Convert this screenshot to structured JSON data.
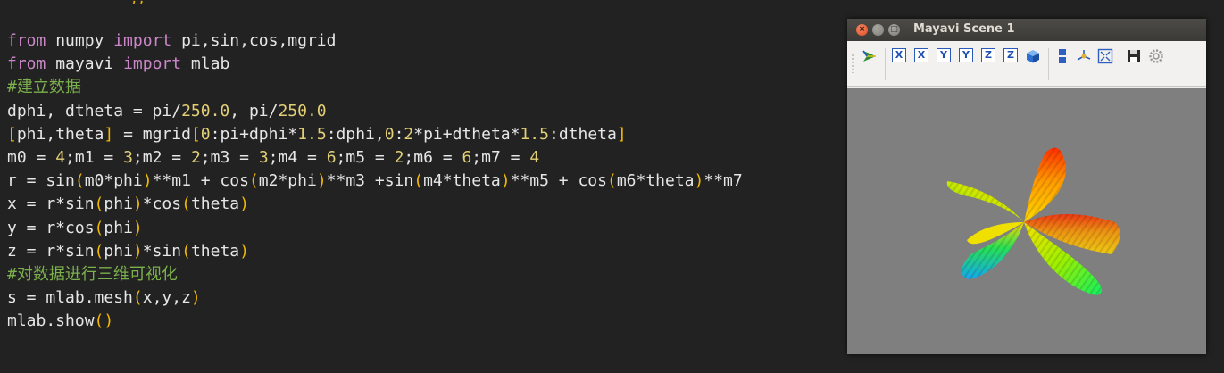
{
  "editor": {
    "lines": [
      {
        "segments": [
          {
            "t": "from",
            "c": "kw"
          },
          {
            "t": " numpy ",
            "c": "tx"
          },
          {
            "t": "import",
            "c": "kw"
          },
          {
            "t": " pi,sin,cos,mgrid",
            "c": "tx"
          }
        ]
      },
      {
        "segments": [
          {
            "t": "from",
            "c": "kw"
          },
          {
            "t": " mayavi ",
            "c": "tx"
          },
          {
            "t": "import",
            "c": "kw"
          },
          {
            "t": " mlab",
            "c": "tx"
          }
        ]
      },
      {
        "segments": [
          {
            "t": "#建立数据",
            "c": "cm"
          }
        ]
      },
      {
        "segments": [
          {
            "t": "dphi, dtheta = pi/",
            "c": "tx"
          },
          {
            "t": "250.0",
            "c": "num"
          },
          {
            "t": ", pi/",
            "c": "tx"
          },
          {
            "t": "250.0",
            "c": "num"
          }
        ]
      },
      {
        "segments": [
          {
            "t": "[",
            "c": "br"
          },
          {
            "t": "phi,theta",
            "c": "tx"
          },
          {
            "t": "]",
            "c": "br"
          },
          {
            "t": " = mgrid",
            "c": "tx"
          },
          {
            "t": "[",
            "c": "br"
          },
          {
            "t": "0",
            "c": "num"
          },
          {
            "t": ":pi+dphi*",
            "c": "tx"
          },
          {
            "t": "1.5",
            "c": "num"
          },
          {
            "t": ":dphi,",
            "c": "tx"
          },
          {
            "t": "0",
            "c": "num"
          },
          {
            "t": ":",
            "c": "tx"
          },
          {
            "t": "2",
            "c": "num"
          },
          {
            "t": "*pi+dtheta*",
            "c": "tx"
          },
          {
            "t": "1.5",
            "c": "num"
          },
          {
            "t": ":dtheta",
            "c": "tx"
          },
          {
            "t": "]",
            "c": "br"
          }
        ]
      },
      {
        "segments": [
          {
            "t": "m0 = ",
            "c": "tx"
          },
          {
            "t": "4",
            "c": "num"
          },
          {
            "t": ";m1 = ",
            "c": "tx"
          },
          {
            "t": "3",
            "c": "num"
          },
          {
            "t": ";m2 = ",
            "c": "tx"
          },
          {
            "t": "2",
            "c": "num"
          },
          {
            "t": ";m3 = ",
            "c": "tx"
          },
          {
            "t": "3",
            "c": "num"
          },
          {
            "t": ";m4 = ",
            "c": "tx"
          },
          {
            "t": "6",
            "c": "num"
          },
          {
            "t": ";m5 = ",
            "c": "tx"
          },
          {
            "t": "2",
            "c": "num"
          },
          {
            "t": ";m6 = ",
            "c": "tx"
          },
          {
            "t": "6",
            "c": "num"
          },
          {
            "t": ";m7 = ",
            "c": "tx"
          },
          {
            "t": "4",
            "c": "num"
          }
        ]
      },
      {
        "segments": [
          {
            "t": "r = sin",
            "c": "tx"
          },
          {
            "t": "(",
            "c": "br"
          },
          {
            "t": "m0*phi",
            "c": "tx"
          },
          {
            "t": ")",
            "c": "br"
          },
          {
            "t": "**m1 + cos",
            "c": "tx"
          },
          {
            "t": "(",
            "c": "br"
          },
          {
            "t": "m2*phi",
            "c": "tx"
          },
          {
            "t": ")",
            "c": "br"
          },
          {
            "t": "**m3 +sin",
            "c": "tx"
          },
          {
            "t": "(",
            "c": "br"
          },
          {
            "t": "m4*theta",
            "c": "tx"
          },
          {
            "t": ")",
            "c": "br"
          },
          {
            "t": "**m5 + cos",
            "c": "tx"
          },
          {
            "t": "(",
            "c": "br"
          },
          {
            "t": "m6*theta",
            "c": "tx"
          },
          {
            "t": ")",
            "c": "br"
          },
          {
            "t": "**m7",
            "c": "tx"
          }
        ]
      },
      {
        "segments": [
          {
            "t": "x = r*sin",
            "c": "tx"
          },
          {
            "t": "(",
            "c": "br"
          },
          {
            "t": "phi",
            "c": "tx"
          },
          {
            "t": ")",
            "c": "br"
          },
          {
            "t": "*cos",
            "c": "tx"
          },
          {
            "t": "(",
            "c": "br"
          },
          {
            "t": "theta",
            "c": "tx"
          },
          {
            "t": ")",
            "c": "br"
          }
        ]
      },
      {
        "segments": [
          {
            "t": "y = r*cos",
            "c": "tx"
          },
          {
            "t": "(",
            "c": "br"
          },
          {
            "t": "phi",
            "c": "tx"
          },
          {
            "t": ")",
            "c": "br"
          }
        ]
      },
      {
        "segments": [
          {
            "t": "z = r*sin",
            "c": "tx"
          },
          {
            "t": "(",
            "c": "br"
          },
          {
            "t": "phi",
            "c": "tx"
          },
          {
            "t": ")",
            "c": "br"
          },
          {
            "t": "*sin",
            "c": "tx"
          },
          {
            "t": "(",
            "c": "br"
          },
          {
            "t": "theta",
            "c": "tx"
          },
          {
            "t": ")",
            "c": "br"
          }
        ]
      },
      {
        "segments": [
          {
            "t": "#对数据进行三维可视化",
            "c": "cm"
          }
        ]
      },
      {
        "segments": [
          {
            "t": "s = mlab.mesh",
            "c": "tx"
          },
          {
            "t": "(",
            "c": "br"
          },
          {
            "t": "x,y,z",
            "c": "tx"
          },
          {
            "t": ")",
            "c": "br"
          }
        ]
      },
      {
        "segments": [
          {
            "t": "mlab.show",
            "c": "tx"
          },
          {
            "t": "()",
            "c": "br"
          }
        ]
      }
    ],
    "colors": {
      "background": "#222222",
      "keyword": "#cc87c9",
      "comment": "#7bb04c",
      "number": "#e2cf76",
      "bracket": "#f2b800",
      "text": "#e6e6e6"
    }
  },
  "mayavi_window": {
    "title": "Mayavi Scene 1",
    "close_glyph": "×",
    "min_glyph": "–",
    "max_glyph": "□",
    "toolbar": {
      "items": [
        {
          "icon": "mayavi-logo-icon"
        },
        {
          "icon": "view-x-plus-icon",
          "label": "X"
        },
        {
          "icon": "view-x-minus-icon",
          "label": "X"
        },
        {
          "icon": "view-y-plus-icon",
          "label": "Y"
        },
        {
          "icon": "view-y-minus-icon",
          "label": "Y"
        },
        {
          "icon": "view-z-plus-icon",
          "label": "Z"
        },
        {
          "icon": "view-z-minus-icon",
          "label": "Z"
        },
        {
          "icon": "isometric-view-icon"
        },
        {
          "icon": "parallel-projection-icon"
        },
        {
          "icon": "axes-indicator-icon"
        },
        {
          "icon": "full-screen-icon"
        },
        {
          "icon": "save-icon"
        },
        {
          "icon": "settings-gear-icon"
        }
      ]
    },
    "scene_background": "#7f7f7f"
  }
}
